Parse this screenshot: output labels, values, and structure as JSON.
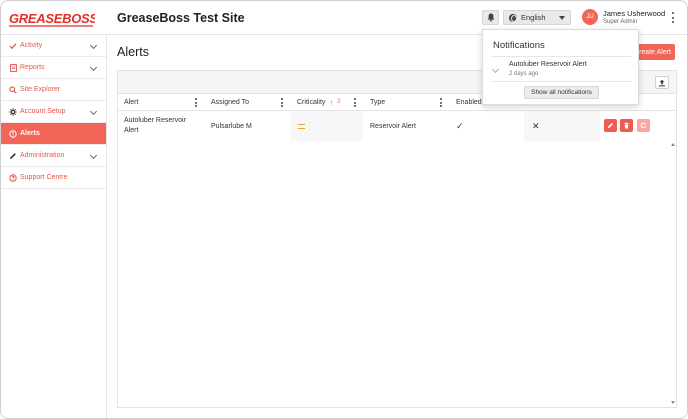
{
  "header": {
    "logo_text": "GREASEBOSS",
    "site_title": "GreaseBoss Test Site",
    "language": "English",
    "user": {
      "initials": "JU",
      "name": "James Usherwood",
      "role": "Super Admin"
    }
  },
  "sidebar": {
    "items": [
      {
        "label": "Activity",
        "icon": "check-icon"
      },
      {
        "label": "Reports",
        "icon": "report-icon"
      },
      {
        "label": "Site Explorer",
        "icon": "search-icon"
      },
      {
        "label": "Account Setup",
        "icon": "gear-icon"
      },
      {
        "label": "Alerts",
        "icon": "alert-icon"
      },
      {
        "label": "Administration",
        "icon": "pencil-icon"
      },
      {
        "label": "Support Centre",
        "icon": "help-icon"
      }
    ]
  },
  "page": {
    "title": "Alerts",
    "create_button": "Create Alert"
  },
  "table": {
    "columns": [
      "Alert",
      "Assigned To",
      "Criticality",
      "Type",
      "Enabled"
    ],
    "sort_index": "2",
    "rows": [
      {
        "alert": "Autoluber Reservoir Alert",
        "assigned_to": "Pulsarlube M",
        "criticality": "medium",
        "type": "Reservoir Alert",
        "enabled": "✓",
        "status": "✕"
      }
    ]
  },
  "notifications": {
    "title": "Notifications",
    "items": [
      {
        "title": "Autoluber Reservoir Alert",
        "time": "2 days ago"
      }
    ],
    "show_all_label": "Show all notifications"
  },
  "colors": {
    "accent": "#f26658",
    "sidebar_text": "#e2574c",
    "medium": "#f5a032"
  }
}
